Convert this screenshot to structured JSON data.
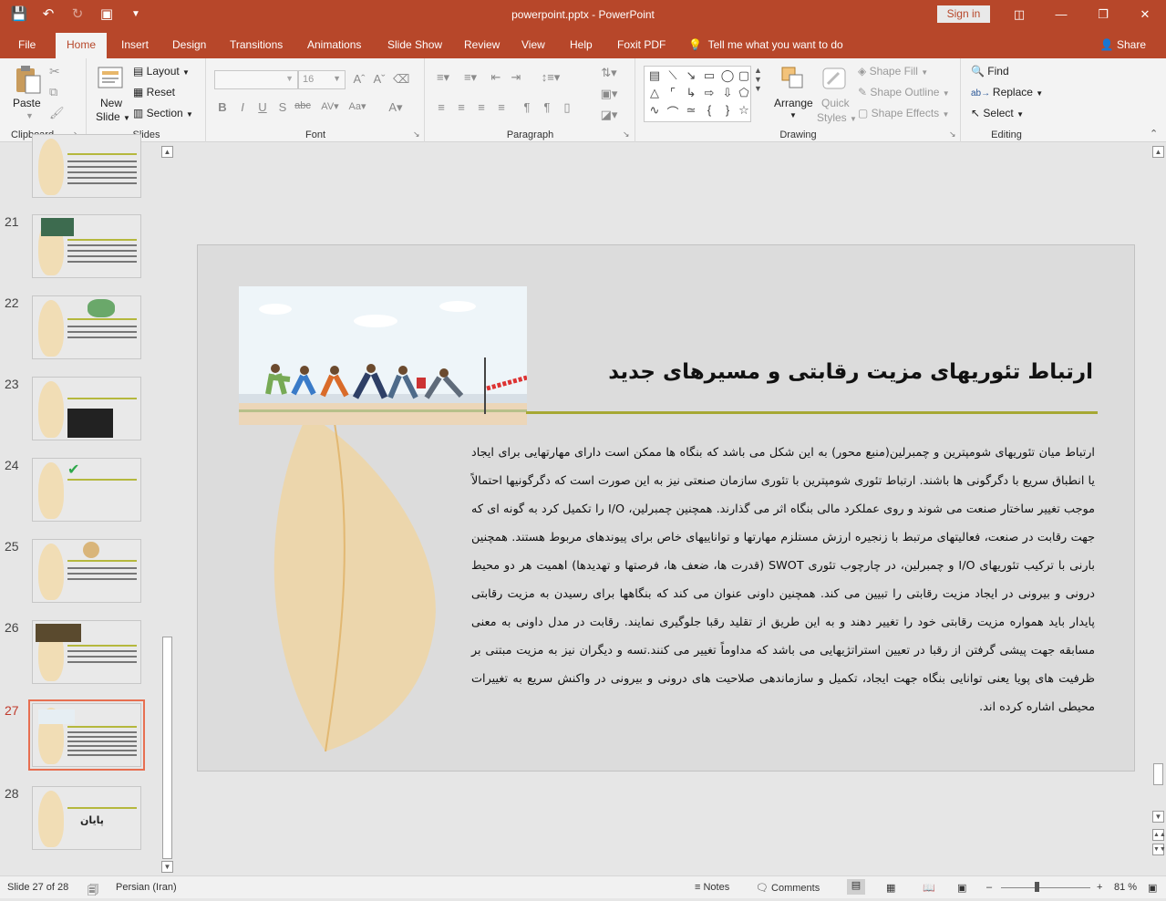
{
  "titlebar": {
    "title": "powerpoint.pptx  -  PowerPoint",
    "sign_in": "Sign in"
  },
  "tabs": {
    "file": "File",
    "home": "Home",
    "insert": "Insert",
    "design": "Design",
    "transitions": "Transitions",
    "animations": "Animations",
    "slideshow": "Slide Show",
    "review": "Review",
    "view": "View",
    "help": "Help",
    "foxit": "Foxit PDF",
    "tellme": "Tell me what you want to do",
    "share": "Share"
  },
  "ribbon": {
    "clipboard": {
      "label": "Clipboard",
      "paste": "Paste"
    },
    "slides": {
      "label": "Slides",
      "new_slide_1": "New",
      "new_slide_2": "Slide",
      "layout": "Layout",
      "reset": "Reset",
      "section": "Section"
    },
    "font": {
      "label": "Font",
      "size": "16"
    },
    "paragraph": {
      "label": "Paragraph"
    },
    "drawing": {
      "label": "Drawing",
      "arrange": "Arrange",
      "quick_styles_1": "Quick",
      "quick_styles_2": "Styles",
      "shape_fill": "Shape Fill",
      "shape_outline": "Shape Outline",
      "shape_effects": "Shape Effects"
    },
    "editing": {
      "label": "Editing",
      "find": "Find",
      "replace": "Replace",
      "select": "Select"
    }
  },
  "thumbnails": [
    {
      "num": "21"
    },
    {
      "num": "22"
    },
    {
      "num": "23"
    },
    {
      "num": "24"
    },
    {
      "num": "25"
    },
    {
      "num": "26"
    },
    {
      "num": "27",
      "selected": true
    },
    {
      "num": "28",
      "text": "پایان"
    }
  ],
  "slide": {
    "title": "ارتباط تئوریهای مزیت رقابتی و مسیرهای جدید",
    "body": "ارتباط میان تئوریهای شومپترین و چمبرلین(منبع محور) به این شکل می باشد که بنگاه ها ممکن است دارای مهارتهایی برای ایجاد یا انطباق سریع با دگرگونی ها باشند. ارتباط تئوری شومپترین با تئوری سازمان صنعتی نیز به این صورت است که دگرگونیها احتمالاً موجب تغییر ساختار صنعت می شوند و روی عملکرد مالی بنگاه اثر می گذارند. همچنین چمبرلین، I/O را تکمیل کرد به گونه ای که جهت رقابت در صنعت، فعالیتهای مرتبط با زنجیره ارزش مستلزم مهارتها و تواناییهای خاص برای پیوندهای مربوط هستند. همچنین بارنی با ترکیب تئوریهای I/O و چمبرلین، در چارچوب تئوری SWOT (قدرت ها، ضعف ها، فرصتها و تهدیدها) اهمیت هر دو محیط درونی و بیرونی در ایجاد مزیت رقابتی را تبیین می کند. همچنین داونی عنوان می کند که بنگاهها برای رسیدن به مزیت رقابتی پایدار باید همواره مزیت رقابتی خود را تغییر دهند و به این طریق از تقلید رقبا جلوگیری نمایند. رقابت در مدل داونی به معنی مسابقه جهت پیشی گرفتن از رقبا در تعیین استراتژیهایی می باشد که مداوماً تغییر می کنند.تسه و دیگران نیز به مزیت مبتنی بر ظرفیت های پویا یعنی توانایی بنگاه جهت ایجاد، تکمیل و سازماندهی صلاحیت  های درونی و بیرونی در واکنش سریع به تغییرات محیطی اشاره کرده اند."
  },
  "status": {
    "slide": "Slide 27 of 28",
    "language": "Persian (Iran)",
    "notes": "Notes",
    "comments": "Comments",
    "zoom": "81 %"
  },
  "colors": {
    "accent": "#b7472a",
    "rule": "#a6a833"
  }
}
